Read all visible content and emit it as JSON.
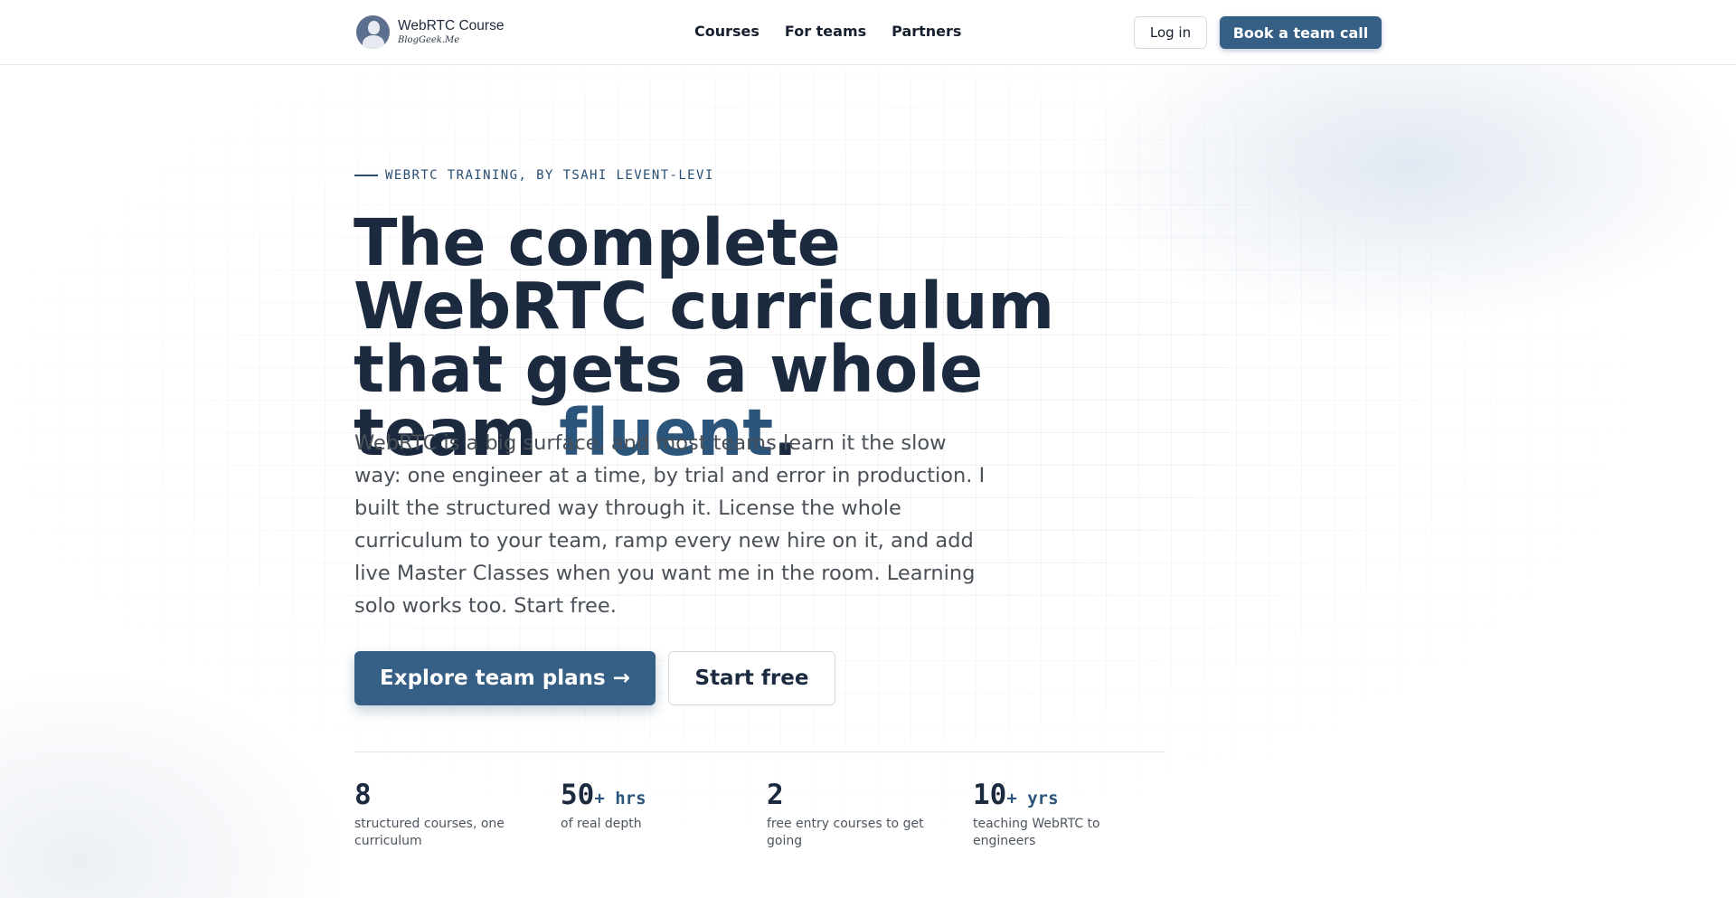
{
  "brand": {
    "title": "WebRTC Course",
    "subtitle": "BlogGeek.Me"
  },
  "nav": {
    "items": [
      "Courses",
      "For teams",
      "Partners"
    ]
  },
  "header_actions": {
    "login": "Log in",
    "book": "Book a team call"
  },
  "hero": {
    "eyebrow": "WEBRTC TRAINING, BY TSAHI LEVENT-LEVI",
    "headline_main": "The complete WebRTC curriculum that gets a whole team ",
    "headline_accent": "fluent",
    "headline_end": ".",
    "lede": "WebRTC is a big surface, and most teams learn it the slow way: one engineer at a time, by trial and error in production. I built the structured way through it. License the whole curriculum to your team, ramp every new hire on it, and add live Master Classes when you want me in the room. Learning solo works too. Start free.",
    "primary_cta": "Explore team plans →",
    "secondary_cta": "Start free"
  },
  "stats": [
    {
      "value": "8",
      "unit": "",
      "label": "structured courses, one curriculum"
    },
    {
      "value": "50",
      "unit": "+ hrs",
      "label": "of real depth"
    },
    {
      "value": "2",
      "unit": "",
      "label": "free entry courses to get going"
    },
    {
      "value": "10",
      "unit": "+ yrs",
      "label": "teaching WebRTC to engineers"
    }
  ],
  "colors": {
    "accent": "#365f85",
    "heading": "#1c2a3f",
    "highlight": "#2b557b"
  }
}
